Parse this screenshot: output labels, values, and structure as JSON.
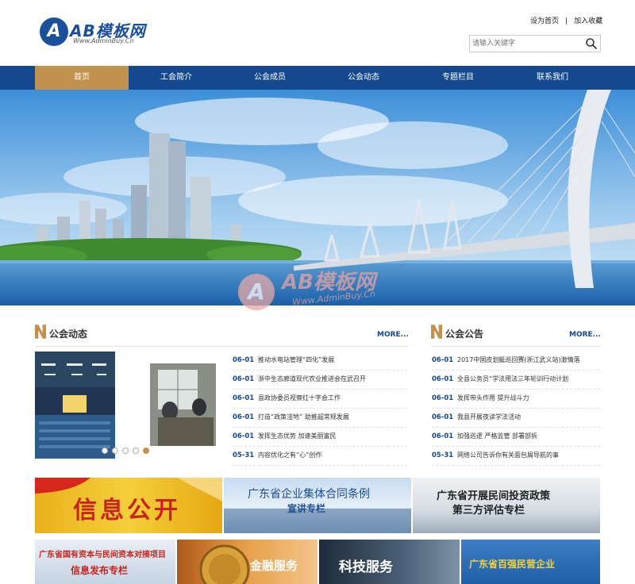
{
  "header": {
    "logo_text": "AB模板网",
    "logo_sub": "Www.AdminBuy.Cn",
    "top_links": [
      "设为首页",
      "加入收藏"
    ],
    "search_placeholder": "请输入关键字"
  },
  "nav": {
    "items": [
      {
        "label": "首页",
        "active": true
      },
      {
        "label": "工会简介",
        "active": false
      },
      {
        "label": "公会成员",
        "active": false
      },
      {
        "label": "公会动态",
        "active": false
      },
      {
        "label": "专题栏目",
        "active": false
      },
      {
        "label": "联系我们",
        "active": false
      }
    ]
  },
  "watermark": {
    "text": "AB模板网",
    "sub": "Www.AdminBuy.Cn"
  },
  "news_section": {
    "title": "公会动态",
    "more": "MORE...",
    "slider_dots": 5,
    "active_dot": 4,
    "items": [
      {
        "date": "06-01",
        "text": "推动水电站管理“四化”发展"
      },
      {
        "date": "06-01",
        "text": "浙中生态廊道现代农业推进会在武召开"
      },
      {
        "date": "06-01",
        "text": "县政协委员视察红十字会工作"
      },
      {
        "date": "06-01",
        "text": "打造“政策洼地” 助推超常规发展"
      },
      {
        "date": "06-01",
        "text": "发挥生态优势 加速美丽富民"
      },
      {
        "date": "05-31",
        "text": "内容优化之有“心”创作"
      }
    ]
  },
  "notice_section": {
    "title": "公会公告",
    "more": "MORE...",
    "items": [
      {
        "date": "06-01",
        "text": "2017中国皮划艇巡回赛(浙江武义站)激情落"
      },
      {
        "date": "06-01",
        "text": "全县公务员“学法用法三年轮训行动计划"
      },
      {
        "date": "06-01",
        "text": "发挥带头作用 提升战斗力"
      },
      {
        "date": "06-01",
        "text": "我县开展夜读学法活动"
      },
      {
        "date": "06-01",
        "text": "加强巡逻 严格监管 部署部拆"
      },
      {
        "date": "05-31",
        "text": "网络公司告诉你有关面包屑导航的事"
      }
    ]
  },
  "tiles_row1": [
    {
      "text": "信息公开"
    },
    {
      "line1": "广东省企业集体合同条例",
      "line2": "宣讲专栏"
    },
    {
      "line1": "广东省开展民间投资政策",
      "line2": "第三方评估专栏"
    }
  ],
  "tiles_row2": [
    {
      "line1": "广东省国有资本与民间资本对接项目",
      "line2": "信息发布专栏"
    },
    {
      "text": "金融服务"
    },
    {
      "text": "科技服务"
    },
    {
      "text": "广东省百强民营企业"
    }
  ],
  "colors": {
    "nav": "#14498f",
    "accent": "#c1924e",
    "brand": "#1a4f9c"
  }
}
